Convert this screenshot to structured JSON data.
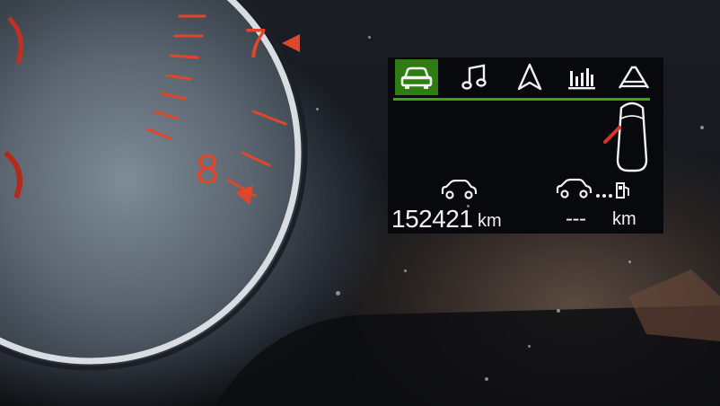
{
  "gauge": {
    "tick_labels": [
      "7",
      "8"
    ],
    "accent_color": "#e0462a"
  },
  "display": {
    "tabs": [
      {
        "icon": "car-icon",
        "active": true
      },
      {
        "icon": "music-note-icon",
        "active": false
      },
      {
        "icon": "navigation-arrow-icon",
        "active": false
      },
      {
        "icon": "bar-chart-icon",
        "active": false
      },
      {
        "icon": "lane-road-icon",
        "active": false
      }
    ],
    "active_color": "#2f7d12",
    "odometer": {
      "value": "152421",
      "unit": "km"
    },
    "range": {
      "value": "---",
      "unit": "km"
    }
  }
}
